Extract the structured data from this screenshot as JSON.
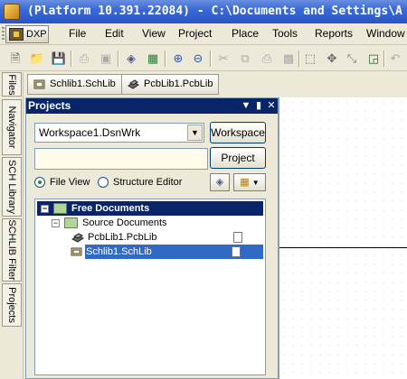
{
  "window": {
    "title": "(Platform 10.391.22084) - C:\\Documents and Settings\\A"
  },
  "menubar": {
    "dxp": "DXP",
    "items": [
      "File",
      "Edit",
      "View",
      "Project",
      "Place",
      "Tools",
      "Reports",
      "Window"
    ]
  },
  "document_tabs": [
    {
      "label": "Schlib1.SchLib",
      "icon": "schlib-doc-icon"
    },
    {
      "label": "PcbLib1.PcbLib",
      "icon": "pcblib-doc-icon"
    }
  ],
  "side_tabs": [
    "Files",
    "Navigator",
    "SCH Library",
    "SCHLIB Filter",
    "Projects"
  ],
  "panel": {
    "title": "Projects",
    "workspace_value": "Workspace1.DsnWrk",
    "workspace_button": "Workspace",
    "project_button": "Project",
    "project_input_value": "",
    "view_options": [
      {
        "label": "File View",
        "selected": true
      },
      {
        "label": "Structure Editor",
        "selected": false
      }
    ]
  },
  "tree": {
    "root": "Free Documents",
    "group": "Source Documents",
    "files": [
      {
        "label": "PcbLib1.PcbLib",
        "selected": false
      },
      {
        "label": "Schlib1.SchLib",
        "selected": true
      }
    ]
  },
  "colors": {
    "title_bar": "#2a55c2",
    "panel_header": "#0a246a",
    "selection": "#316ac5"
  }
}
